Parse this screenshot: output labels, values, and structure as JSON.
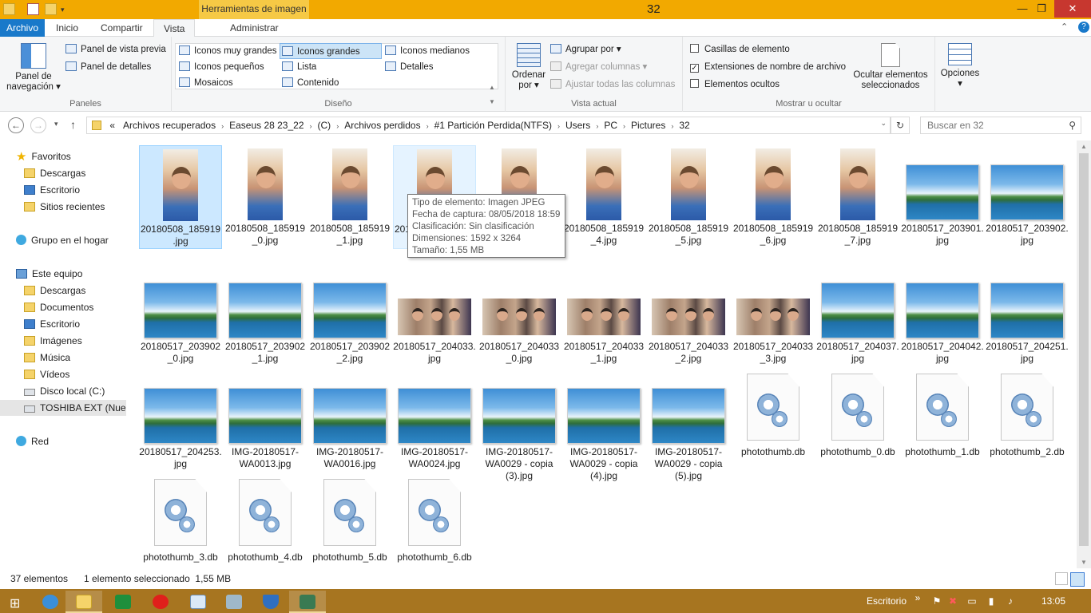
{
  "window": {
    "title": "32",
    "context_tab": "Herramientas de imagen",
    "minimize": "—",
    "maximize": "❐",
    "close": "✕"
  },
  "tabs": {
    "archivo": "Archivo",
    "inicio": "Inicio",
    "compartir": "Compartir",
    "vista": "Vista",
    "administrar": "Administrar"
  },
  "ribbon": {
    "paneles": {
      "label": "Paneles",
      "panel_navegacion": "Panel de navegación ▾",
      "vista_previa": "Panel de vista previa",
      "detalles": "Panel de detalles"
    },
    "diseno": {
      "label": "Diseño",
      "iconos_muy_grandes": "Iconos muy grandes",
      "iconos_grandes": "Iconos grandes",
      "iconos_medianos": "Iconos medianos",
      "iconos_pequenos": "Iconos pequeños",
      "lista": "Lista",
      "detalles": "Detalles",
      "mosaicos": "Mosaicos",
      "contenido": "Contenido"
    },
    "vista_actual": {
      "label": "Vista actual",
      "ordenar_por": "Ordenar por ▾",
      "agrupar_por": "Agrupar por ▾",
      "agregar_columnas": "Agregar columnas ▾",
      "ajustar_columnas": "Ajustar todas las columnas"
    },
    "mostrar": {
      "label": "Mostrar u ocultar",
      "casillas": "Casillas de elemento",
      "extensiones": "Extensiones de nombre de archivo",
      "ocultos": "Elementos ocultos",
      "ocultar_sel": "Ocultar elementos seleccionados",
      "casillas_checked": false,
      "extensiones_checked": true,
      "ocultos_checked": false
    },
    "opciones": "Opciones"
  },
  "address": {
    "crumbs": [
      "«",
      "Archivos recuperados",
      "Easeus 28 23_22",
      "(C)",
      "Archivos perdidos",
      "#1 Partición Perdida(NTFS)",
      "Users",
      "PC",
      "Pictures",
      "32"
    ],
    "search_placeholder": "Buscar en 32"
  },
  "nav": {
    "favoritos": "Favoritos",
    "descargas": "Descargas",
    "escritorio": "Escritorio",
    "sitios_recientes": "Sitios recientes",
    "grupo_hogar": "Grupo en el hogar",
    "este_equipo": "Este equipo",
    "pc_descargas": "Descargas",
    "documentos": "Documentos",
    "pc_escritorio": "Escritorio",
    "imagenes": "Imágenes",
    "musica": "Música",
    "videos": "Vídeos",
    "disco_local": "Disco local (C:)",
    "toshiba": "TOSHIBA EXT (Nuer",
    "red": "Red"
  },
  "files": [
    {
      "name": "20180508_185919.jpg",
      "kind": "portrait",
      "state": "selected"
    },
    {
      "name": "20180508_185919_0.jpg",
      "kind": "portrait"
    },
    {
      "name": "20180508_185919_1.jpg",
      "kind": "portrait"
    },
    {
      "name": "20180508_185919_2.jpg",
      "kind": "portrait",
      "state": "hover"
    },
    {
      "name": "20180508_185919_3.jpg",
      "kind": "portrait"
    },
    {
      "name": "20180508_185919_4.jpg",
      "kind": "portrait"
    },
    {
      "name": "20180508_185919_5.jpg",
      "kind": "portrait"
    },
    {
      "name": "20180508_185919_6.jpg",
      "kind": "portrait"
    },
    {
      "name": "20180508_185919_7.jpg",
      "kind": "portrait"
    },
    {
      "name": "20180517_203901.jpg",
      "kind": "landscape"
    },
    {
      "name": "20180517_203902.jpg",
      "kind": "landscape"
    },
    {
      "name": "20180517_203902_0.jpg",
      "kind": "landscape"
    },
    {
      "name": "20180517_203902_1.jpg",
      "kind": "landscape"
    },
    {
      "name": "20180517_203902_2.jpg",
      "kind": "landscape"
    },
    {
      "name": "20180517_204033.jpg",
      "kind": "group"
    },
    {
      "name": "20180517_204033_0.jpg",
      "kind": "group"
    },
    {
      "name": "20180517_204033_1.jpg",
      "kind": "group"
    },
    {
      "name": "20180517_204033_2.jpg",
      "kind": "group"
    },
    {
      "name": "20180517_204033_3.jpg",
      "kind": "group"
    },
    {
      "name": "20180517_204037.jpg",
      "kind": "landscape"
    },
    {
      "name": "20180517_204042.jpg",
      "kind": "landscape"
    },
    {
      "name": "20180517_204251.jpg",
      "kind": "landscape"
    },
    {
      "name": "20180517_204253.jpg",
      "kind": "landscape"
    },
    {
      "name": "IMG-20180517-WA0013.jpg",
      "kind": "landscape"
    },
    {
      "name": "IMG-20180517-WA0016.jpg",
      "kind": "landscape"
    },
    {
      "name": "IMG-20180517-WA0024.jpg",
      "kind": "landscape"
    },
    {
      "name": "IMG-20180517-WA0029 - copia (3).jpg",
      "kind": "landscape"
    },
    {
      "name": "IMG-20180517-WA0029 - copia (4).jpg",
      "kind": "landscape"
    },
    {
      "name": "IMG-20180517-WA0029 - copia (5).jpg",
      "kind": "landscape"
    },
    {
      "name": "photothumb.db",
      "kind": "db"
    },
    {
      "name": "photothumb_0.db",
      "kind": "db"
    },
    {
      "name": "photothumb_1.db",
      "kind": "db"
    },
    {
      "name": "photothumb_2.db",
      "kind": "db"
    },
    {
      "name": "photothumb_3.db",
      "kind": "db"
    },
    {
      "name": "photothumb_4.db",
      "kind": "db"
    },
    {
      "name": "photothumb_5.db",
      "kind": "db"
    },
    {
      "name": "photothumb_6.db",
      "kind": "db"
    }
  ],
  "tooltip": {
    "tipo": "Tipo de elemento: Imagen JPEG",
    "fecha": "Fecha de captura: 08/05/2018 18:59",
    "clasificacion": "Clasificación: Sin clasificación",
    "dimensiones": "Dimensiones: 1592 x 3264",
    "tamano": "Tamaño: 1,55 MB"
  },
  "status": {
    "count": "37 elementos",
    "selection": "1 elemento seleccionado  1,55 MB"
  },
  "taskbar": {
    "desktop_label": "Escritorio",
    "clock": "13:05",
    "tray_expand": "»"
  },
  "colors": {
    "accent": "#1979ca",
    "titlebar": "#f2a900",
    "taskbar": "#a77520",
    "selection": "#cce8ff"
  },
  "icons": [
    "back-arrow-icon",
    "forward-arrow-icon",
    "up-arrow-icon",
    "refresh-icon",
    "search-icon",
    "star-icon",
    "folder-icon",
    "gear-file-icon"
  ]
}
